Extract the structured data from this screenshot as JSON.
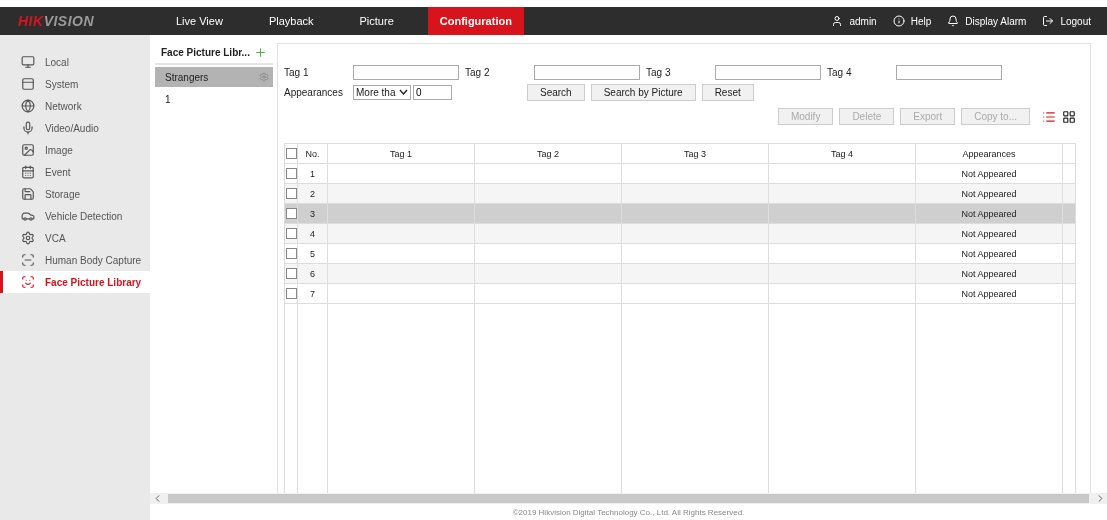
{
  "logo": {
    "accent": "HIK",
    "rest": "VISION"
  },
  "tabs": [
    {
      "label": "Live View",
      "selected": false
    },
    {
      "label": "Playback",
      "selected": false
    },
    {
      "label": "Picture",
      "selected": false
    },
    {
      "label": "Configuration",
      "selected": true
    }
  ],
  "user_menu": [
    {
      "kind": "user",
      "label": "admin"
    },
    {
      "kind": "help",
      "label": "Help"
    },
    {
      "kind": "alarm",
      "label": "Display Alarm"
    },
    {
      "kind": "logout",
      "label": "Logout"
    }
  ],
  "sidebar": {
    "items": [
      {
        "kind": "local",
        "label": "Local",
        "selected": false
      },
      {
        "kind": "system",
        "label": "System",
        "selected": false
      },
      {
        "kind": "network",
        "label": "Network",
        "selected": false
      },
      {
        "kind": "video",
        "label": "Video/Audio",
        "selected": false
      },
      {
        "kind": "image",
        "label": "Image",
        "selected": false
      },
      {
        "kind": "event",
        "label": "Event",
        "selected": false
      },
      {
        "kind": "storage",
        "label": "Storage",
        "selected": false
      },
      {
        "kind": "vehicle",
        "label": "Vehicle Detection",
        "selected": false
      },
      {
        "kind": "vca",
        "label": "VCA",
        "selected": false
      },
      {
        "kind": "body",
        "label": "Human Body Capture",
        "selected": false
      },
      {
        "kind": "face",
        "label": "Face Picture Library",
        "selected": true
      }
    ]
  },
  "library": {
    "title": "Face Picture Libr...",
    "items": [
      {
        "label": "Strangers",
        "selected": true
      },
      {
        "label": "1",
        "selected": false
      }
    ]
  },
  "search": {
    "tags": [
      {
        "label": "Tag 1"
      },
      {
        "label": "Tag 2"
      },
      {
        "label": "Tag 3"
      },
      {
        "label": "Tag 4"
      }
    ],
    "appearances_label": "Appearances",
    "appearances_mode": "More tha",
    "appearances_value": "0",
    "buttons": [
      "Search",
      "Search by Picture",
      "Reset"
    ]
  },
  "actions": [
    {
      "label": "Modify",
      "disabled": true
    },
    {
      "label": "Delete",
      "disabled": true
    },
    {
      "label": "Export",
      "disabled": true
    },
    {
      "label": "Copy to...",
      "disabled": true
    }
  ],
  "views": [
    {
      "kind": "list",
      "selected": true
    },
    {
      "kind": "grid",
      "selected": false
    }
  ],
  "table": {
    "select_all": false,
    "columns": [
      "No.",
      "Tag 1",
      "Tag 2",
      "Tag 3",
      "Tag 4",
      "Appearances"
    ],
    "rows": [
      {
        "no": "1",
        "appearances": "Not Appeared",
        "checked": false,
        "selected": false
      },
      {
        "no": "2",
        "appearances": "Not Appeared",
        "checked": false,
        "selected": false
      },
      {
        "no": "3",
        "appearances": "Not Appeared",
        "checked": false,
        "selected": true
      },
      {
        "no": "4",
        "appearances": "Not Appeared",
        "checked": false,
        "selected": false
      },
      {
        "no": "5",
        "appearances": "Not Appeared",
        "checked": false,
        "selected": false
      },
      {
        "no": "6",
        "appearances": "Not Appeared",
        "checked": false,
        "selected": false
      },
      {
        "no": "7",
        "appearances": "Not Appeared",
        "checked": false,
        "selected": false
      }
    ]
  },
  "footer": "©2019 Hikvision Digital Technology Co., Ltd. All Rights Reserved."
}
